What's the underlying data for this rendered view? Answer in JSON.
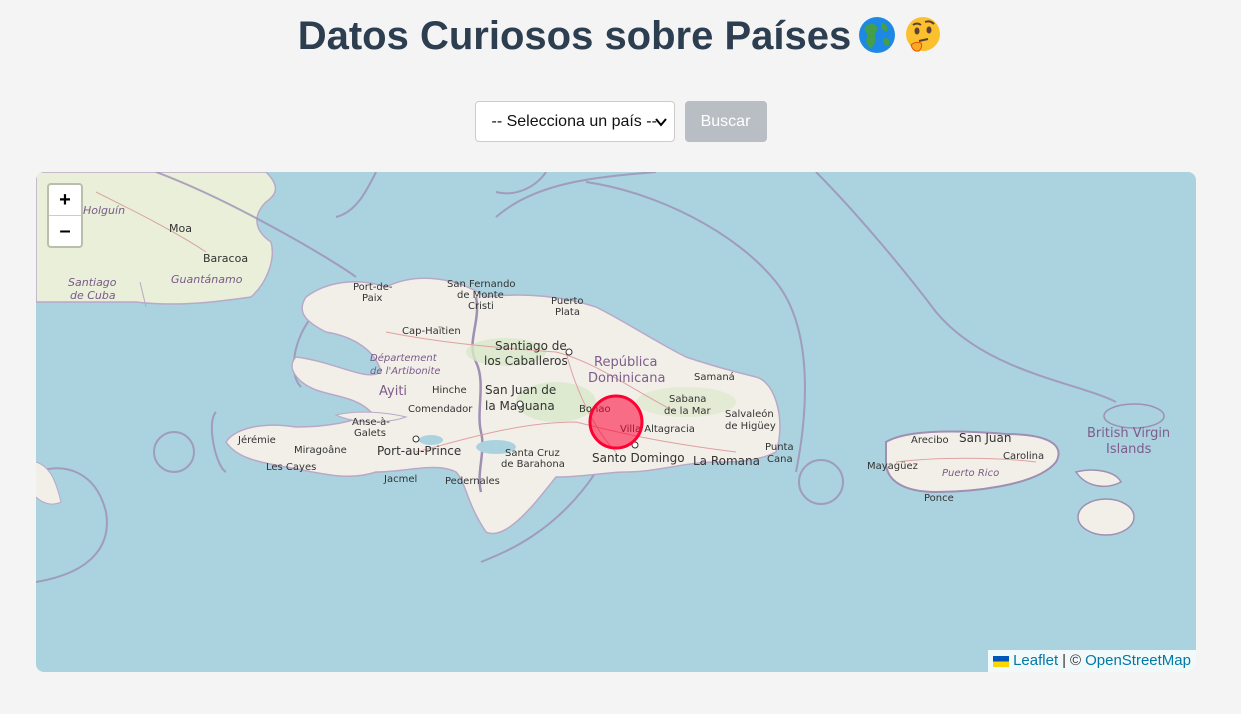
{
  "header": {
    "title": "Datos Curiosos sobre Países",
    "emoji_icons": [
      "globe-americas-icon",
      "thinking-face-icon"
    ]
  },
  "controls": {
    "select_value": "-- Selecciona un país --",
    "search_label": "Buscar"
  },
  "map": {
    "zoom_in_label": "+",
    "zoom_out_label": "–",
    "attribution": {
      "leaflet": "Leaflet",
      "separator": "|",
      "copyright": "©",
      "osm": "OpenStreetMap"
    },
    "marker_color": "#ff0033",
    "water_color": "#aad3df",
    "land_color": "#f2efe9",
    "labels": {
      "holguin": "Holguín",
      "moa": "Moa",
      "baracoa": "Baracoa",
      "santiago_de": "Santiago",
      "de_cuba": "de Cuba",
      "guantanamo": "Guantánamo",
      "port_de": "Port-de-",
      "paix": "Paix",
      "san_fernando": "San Fernando",
      "de_monte": "de Monte",
      "cristi": "Cristi",
      "puerto": "Puerto",
      "plata": "Plata",
      "cap_haitien": "Cap-Haïtien",
      "santiago_de_2": "Santiago de",
      "los_caballeros": "los Caballeros",
      "departement": "Département",
      "de_artibonite": "de l'Artibonite",
      "republica": "República",
      "dominicana": "Dominicana",
      "samana": "Samaná",
      "ayiti": "Ayiti",
      "hinche": "Hinche",
      "san_juan_de": "San Juan de",
      "la_maguana": "la Maguana",
      "comendador": "Comendador",
      "bonao": "Bonao",
      "sabana": "Sabana",
      "de_la_mar": "de la Mar",
      "salvaleon": "Salvaleón",
      "de_higuey": "de Higüey",
      "anse_a": "Anse-à-",
      "galets": "Galets",
      "villa_altagracia": "Villa Altagracia",
      "jeremie": "Jérémie",
      "miragoane": "Miragoâne",
      "port_au_prince": "Port-au-Prince",
      "santa_cruz": "Santa Cruz",
      "de_barahona": "de Barahona",
      "santo_domingo": "Santo Domingo",
      "la_romana": "La Romana",
      "punta": "Punta",
      "cana": "Cana",
      "les_cayes": "Les Cayes",
      "jacmel": "Jacmel",
      "pedernales": "Pedernales",
      "arecibo": "Arecibo",
      "san_juan": "San Juan",
      "carolina": "Carolina",
      "mayaguez": "Mayagüez",
      "puerto_rico": "Puerto Rico",
      "ponce": "Ponce",
      "bvi_1": "British Virgin",
      "bvi_2": "Islands"
    }
  }
}
